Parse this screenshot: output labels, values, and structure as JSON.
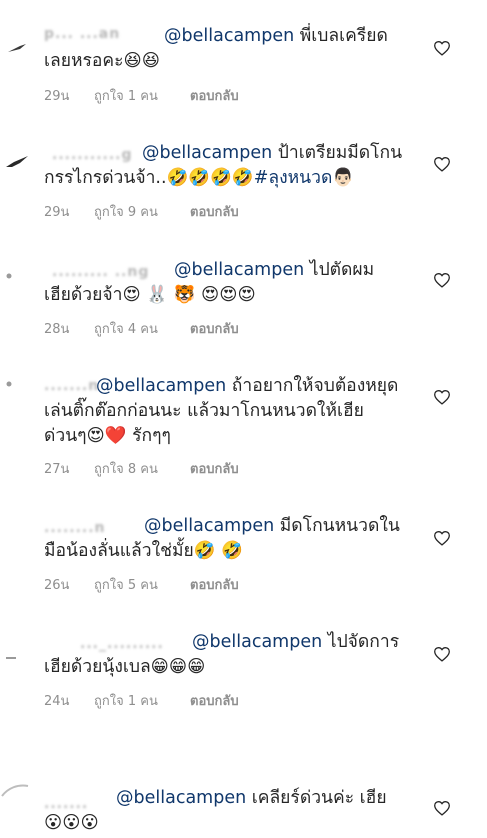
{
  "comments": [
    {
      "user_blur": "p... ...an",
      "mention": "@bellacampen",
      "line1": "พี่เบลเครียด",
      "line2": "เลยหรอคะ😆😆",
      "time": "29น",
      "likes": "ถูกใจ 1 คน",
      "reply": "ตอบกลับ"
    },
    {
      "user_blur": "...........g",
      "mention": "@bellacampen",
      "line1": "ป้าเตรียมมีดโกน",
      "line2_text": "กรรไกรด่วนจ้า..🤣🤣🤣🤣",
      "line2_tag": "#ลุงหนวด",
      "line2_emoji": "👨🏻",
      "time": "29น",
      "likes": "ถูกใจ 9 คน",
      "reply": "ตอบกลับ"
    },
    {
      "user_blur": "......... ..ng",
      "mention": "@bellacampen",
      "line1": "ไปตัดผม",
      "line2": "เฮียด้วยจ้า😍 🐰 🐯 😍😍😍",
      "time": "28น",
      "likes": "ถูกใจ 4 คน",
      "reply": "ตอบกลับ"
    },
    {
      "user_blur": ".......n",
      "mention": "@bellacampen",
      "line1": "ถ้าอยากให้จบต้องหยุด",
      "line2": "เล่นติ๊กต๊อกก่อนนะ แล้วมาโกนหนวดให้เฮีย",
      "line3": "ด่วนๆ😍❤️ รักๆๆ",
      "time": "27น",
      "likes": "ถูกใจ 8 คน",
      "reply": "ตอบกลับ"
    },
    {
      "user_blur": "........n",
      "mention": "@bellacampen",
      "line1": "มีดโกนหนวดใน",
      "line2": "มือน้องลั่นแล้วใช่มั้ย🤣 🤣",
      "time": "26น",
      "likes": "ถูกใจ 5 คน",
      "reply": "ตอบกลับ"
    },
    {
      "user_blur": "..._.........",
      "mention": "@bellacampen",
      "line1": "ไปจัดการ",
      "line2": "เฮียด้วยนุ้งเบล😁😁😁",
      "time": "24น",
      "likes": "ถูกใจ 1 คน",
      "reply": "ตอบกลับ"
    },
    {
      "user_blur": ".......",
      "mention": "@bellacampen",
      "line1": "เคลียร์ด่วนค่ะ  เฮีย",
      "line2": "😮😮😮"
    }
  ],
  "icons": {
    "like": "heart-outline-icon",
    "avatar": "avatar-icon"
  }
}
